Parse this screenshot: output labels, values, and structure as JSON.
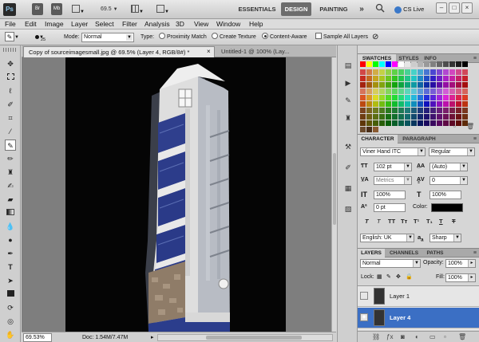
{
  "appbar": {
    "app_logo": "Ps",
    "br_label": "Br",
    "mb_label": "Mb",
    "zoom": "69.5",
    "workspaces": [
      "ESSENTIALS",
      "DESIGN",
      "PAINTING"
    ],
    "more": "»",
    "cs_live": "CS Live",
    "window_controls": [
      "–",
      "□",
      "×"
    ]
  },
  "menu": [
    "File",
    "Edit",
    "Image",
    "Layer",
    "Select",
    "Filter",
    "Analysis",
    "3D",
    "View",
    "Window",
    "Help"
  ],
  "options": {
    "brush_size": "25",
    "mode_label": "Mode:",
    "mode_value": "Normal",
    "type_label": "Type:",
    "type_options": [
      "Proximity Match",
      "Create Texture",
      "Content-Aware"
    ],
    "sample_all": "Sample All Layers"
  },
  "tabs": [
    "Copy of sourceimagesmall.jpg @ 69.5% (Layer 4, RGB/8#) *",
    "Untitled-1 @ 100% (Lay..."
  ],
  "tab_close": "×",
  "status": {
    "zoom": "69.53%",
    "doc": "Doc: 1.54M/7.47M"
  },
  "swatches": {
    "tabs": [
      "SWATCHES",
      "STYLES",
      "INFO"
    ],
    "colors": [
      "#ff0000",
      "#ffff00",
      "#00ff00",
      "#00ffff",
      "#0000ff",
      "#ff00ff",
      "#ffffff",
      "#e6e6e6",
      "#cccccc",
      "#b3b3b3",
      "#999999",
      "#808080",
      "#666666",
      "#4d4d4d",
      "#333333",
      "#1a1a1a",
      "#000000"
    ]
  },
  "character": {
    "tabs": [
      "CHARACTER",
      "PARAGRAPH"
    ],
    "font_family": "Viner Hand ITC",
    "font_style": "Regular",
    "size": "102 pt",
    "leading": "(Auto)",
    "kerning": "Metrics",
    "tracking": "0",
    "vscale": "100%",
    "hscale": "100%",
    "baseline": "0 pt",
    "color_label": "Color:",
    "color": "#000000",
    "glyph_buttons": [
      "T",
      "T",
      "TT",
      "Tт",
      "T¹",
      "T₁",
      "T",
      "T"
    ],
    "language": "English: UK",
    "aa_label": "a",
    "aa_sub": "a",
    "antialias": "Sharp"
  },
  "layers": {
    "tabs": [
      "LAYERS",
      "CHANNELS",
      "PATHS"
    ],
    "blend": "Normal",
    "opacity_label": "Opacity:",
    "opacity": "100%",
    "lock_label": "Lock:",
    "fill_label": "Fill:",
    "fill": "100%",
    "items": [
      {
        "name": "Layer 1",
        "selected": false,
        "visible": false
      },
      {
        "name": "Layer 4",
        "selected": true,
        "visible": true
      }
    ]
  }
}
